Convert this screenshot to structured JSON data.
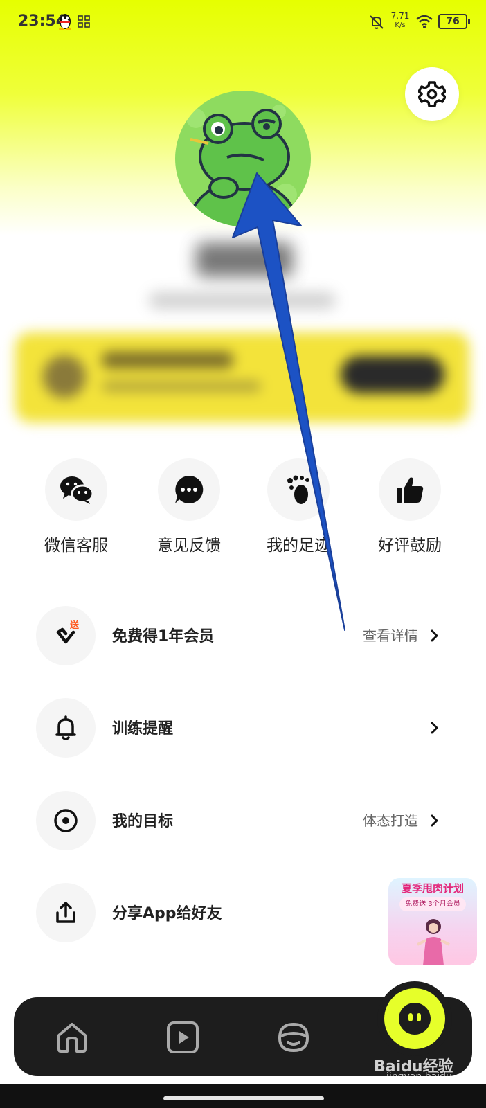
{
  "status_bar": {
    "time": "23:54",
    "net_speed": "7.71",
    "net_unit": "K/s",
    "battery": "76"
  },
  "icons": {
    "settings": "gear-icon",
    "qq": "qq-icon",
    "notification_off": "bell-off-icon",
    "wifi": "wifi-icon"
  },
  "quick_actions": [
    {
      "label": "微信客服",
      "icon": "wechat-icon"
    },
    {
      "label": "意见反馈",
      "icon": "chat-bubble-icon"
    },
    {
      "label": "我的足迹",
      "icon": "footprint-icon"
    },
    {
      "label": "好评鼓励",
      "icon": "thumbs-up-icon"
    }
  ],
  "menu": [
    {
      "title": "免费得1年会员",
      "value": "查看详情",
      "badge": "送",
      "icon": "gift-heart-icon"
    },
    {
      "title": "训练提醒",
      "value": "",
      "icon": "bell-icon"
    },
    {
      "title": "我的目标",
      "value": "体态打造",
      "icon": "target-icon"
    },
    {
      "title": "分享App给好友",
      "value": "",
      "icon": "share-icon"
    }
  ],
  "promo": {
    "title": "夏季甩肉计划",
    "subtitle": "免费送 3个月会员"
  },
  "bottom_nav": [
    {
      "icon": "home-icon"
    },
    {
      "icon": "play-icon"
    },
    {
      "icon": "community-icon"
    },
    {
      "icon": "profile-face-icon",
      "active": true
    }
  ],
  "watermark": {
    "text": "Baidu经验",
    "url": "jingyan.baidu.com"
  },
  "colors": {
    "accent": "#e6ff2a",
    "nav_bg": "#1d1d1d",
    "annotation_arrow": "#1c52c4"
  }
}
